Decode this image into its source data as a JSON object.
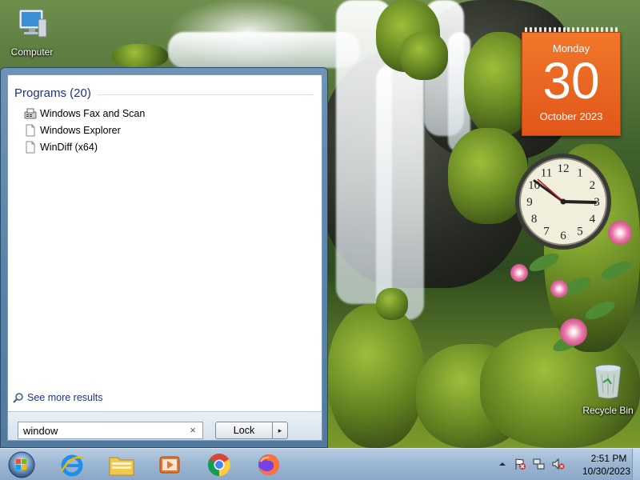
{
  "desktop": {
    "icons": [
      {
        "label": "Computer",
        "icon": "computer-icon"
      },
      {
        "label": "Recycle Bin",
        "icon": "recycle-bin-icon"
      }
    ]
  },
  "calendar_gadget": {
    "day_of_week": "Monday",
    "day": "30",
    "month_year": "October 2023"
  },
  "clock_gadget": {
    "numbers": [
      "12",
      "1",
      "2",
      "3",
      "4",
      "5",
      "6",
      "7",
      "8",
      "9",
      "10",
      "11"
    ]
  },
  "start_menu": {
    "section_title": "Programs (20)",
    "results": [
      {
        "label": "Windows Fax and Scan",
        "icon": "fax-icon"
      },
      {
        "label": "Windows Explorer",
        "icon": "file-icon"
      },
      {
        "label": "WinDiff (x64)",
        "icon": "file-icon"
      }
    ],
    "see_more": "See more results",
    "search_value": "window",
    "clear_glyph": "×",
    "lock_label": "Lock",
    "arrow_glyph": "▸"
  },
  "taskbar": {
    "pinned": [
      "internet-explorer-icon",
      "file-explorer-icon",
      "media-player-icon",
      "chrome-icon",
      "firefox-icon"
    ],
    "tray_icons": [
      "show-hidden-icons-arrow",
      "action-center-icon",
      "network-icon",
      "volume-muted-icon"
    ],
    "time": "2:51 PM",
    "date": "10/30/2023"
  },
  "colors": {
    "accent": "#1e3287",
    "calendar": "#e2561a",
    "taskbar": "#9db7d3"
  }
}
